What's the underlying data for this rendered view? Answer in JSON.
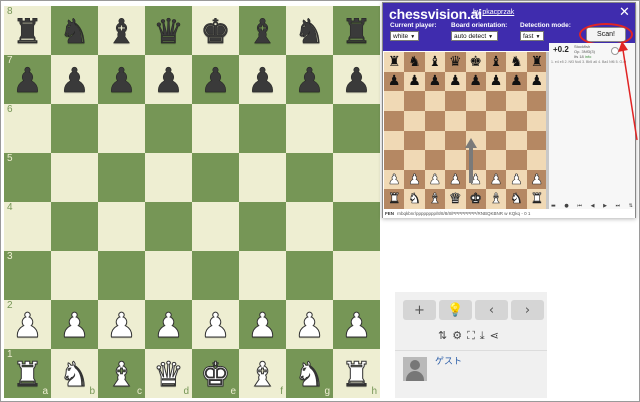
{
  "board": {
    "rows": [
      {
        "rank": "8",
        "pieces": [
          [
            "b",
            "♜"
          ],
          [
            "b",
            "♞"
          ],
          [
            "b",
            "♝"
          ],
          [
            "b",
            "♛"
          ],
          [
            "b",
            "♚"
          ],
          [
            "b",
            "♝"
          ],
          [
            "b",
            "♞"
          ],
          [
            "b",
            "♜"
          ]
        ]
      },
      {
        "rank": "7",
        "pieces": [
          [
            "b",
            "♟"
          ],
          [
            "b",
            "♟"
          ],
          [
            "b",
            "♟"
          ],
          [
            "b",
            "♟"
          ],
          [
            "b",
            "♟"
          ],
          [
            "b",
            "♟"
          ],
          [
            "b",
            "♟"
          ],
          [
            "b",
            "♟"
          ]
        ]
      },
      {
        "rank": "6",
        "pieces": [
          null,
          null,
          null,
          null,
          null,
          null,
          null,
          null
        ]
      },
      {
        "rank": "5",
        "pieces": [
          null,
          null,
          null,
          null,
          null,
          null,
          null,
          null
        ]
      },
      {
        "rank": "4",
        "pieces": [
          null,
          null,
          null,
          null,
          null,
          null,
          null,
          null
        ]
      },
      {
        "rank": "3",
        "pieces": [
          null,
          null,
          null,
          null,
          null,
          null,
          null,
          null
        ]
      },
      {
        "rank": "2",
        "pieces": [
          [
            "w",
            "♟"
          ],
          [
            "w",
            "♟"
          ],
          [
            "w",
            "♟"
          ],
          [
            "w",
            "♟"
          ],
          [
            "w",
            "♟"
          ],
          [
            "w",
            "♟"
          ],
          [
            "w",
            "♟"
          ],
          [
            "w",
            "♟"
          ]
        ]
      },
      {
        "rank": "1",
        "pieces": [
          [
            "w",
            "♜"
          ],
          [
            "w",
            "♞"
          ],
          [
            "w",
            "♝"
          ],
          [
            "w",
            "♛"
          ],
          [
            "w",
            "♚"
          ],
          [
            "w",
            "♝"
          ],
          [
            "w",
            "♞"
          ],
          [
            "w",
            "♜"
          ]
        ]
      }
    ],
    "files": [
      "a",
      "b",
      "c",
      "d",
      "e",
      "f",
      "g",
      "h"
    ],
    "colors": {
      "light": "#eeeed2",
      "dark": "#769656"
    }
  },
  "chessvision": {
    "logo": "chessvision.ai",
    "by": "by",
    "author": "pkacprzak",
    "close": "✕",
    "current_player_label": "Current player:",
    "current_player_value": "white",
    "orientation_label": "Board orientation:",
    "orientation_value": "auto detect",
    "detection_label": "Detection mode:",
    "detection_value": "fast",
    "scan_label": "Scan!",
    "fen_label": "FEN",
    "fen_value": "rnbqkbnr/pppppppp/8/8/8/8/PPPPPPPP/RNBQKBNR w KQkq - 0 1",
    "mini_rows": [
      [
        [
          "b",
          "♜"
        ],
        [
          "b",
          "♞"
        ],
        [
          "b",
          "♝"
        ],
        [
          "b",
          "♛"
        ],
        [
          "b",
          "♚"
        ],
        [
          "b",
          "♝"
        ],
        [
          "b",
          "♞"
        ],
        [
          "b",
          "♜"
        ]
      ],
      [
        [
          "b",
          "♟"
        ],
        [
          "b",
          "♟"
        ],
        [
          "b",
          "♟"
        ],
        [
          "b",
          "♟"
        ],
        [
          "b",
          "♟"
        ],
        [
          "b",
          "♟"
        ],
        [
          "b",
          "♟"
        ],
        [
          "b",
          "♟"
        ]
      ],
      [
        null,
        null,
        null,
        null,
        null,
        null,
        null,
        null
      ],
      [
        null,
        null,
        null,
        null,
        null,
        null,
        null,
        null
      ],
      [
        null,
        null,
        null,
        null,
        null,
        null,
        null,
        null
      ],
      [
        null,
        null,
        null,
        null,
        null,
        null,
        null,
        null
      ],
      [
        [
          "w",
          "♟"
        ],
        [
          "w",
          "♟"
        ],
        [
          "w",
          "♟"
        ],
        [
          "w",
          "♟"
        ],
        [
          "w",
          "♟"
        ],
        [
          "w",
          "♟"
        ],
        [
          "w",
          "♟"
        ],
        [
          "w",
          "♟"
        ]
      ],
      [
        [
          "w",
          "♜"
        ],
        [
          "w",
          "♞"
        ],
        [
          "w",
          "♝"
        ],
        [
          "w",
          "♛"
        ],
        [
          "w",
          "♚"
        ],
        [
          "w",
          "♝"
        ],
        [
          "w",
          "♞"
        ],
        [
          "w",
          "♜"
        ]
      ]
    ],
    "header_color": "#3f2cae"
  },
  "engine": {
    "score": "+0.2",
    "info_line1": "Stockfish",
    "info_line2": "Op. 3Nf3(3)",
    "info_line3": "Ifs 18",
    "tag": "info",
    "line": "1. e4 e5 2. Nf3 Nc6 3. Bb5 a6 4. Ba4 Nf6 5. O-O"
  },
  "side_panel": {
    "add_label": "+",
    "hint_label": "💡",
    "prev_label": "‹",
    "next_label": "›",
    "tools": [
      "⇅",
      "⚙",
      "⛶",
      "⤓",
      "⋖"
    ],
    "username": "ゲスト"
  }
}
